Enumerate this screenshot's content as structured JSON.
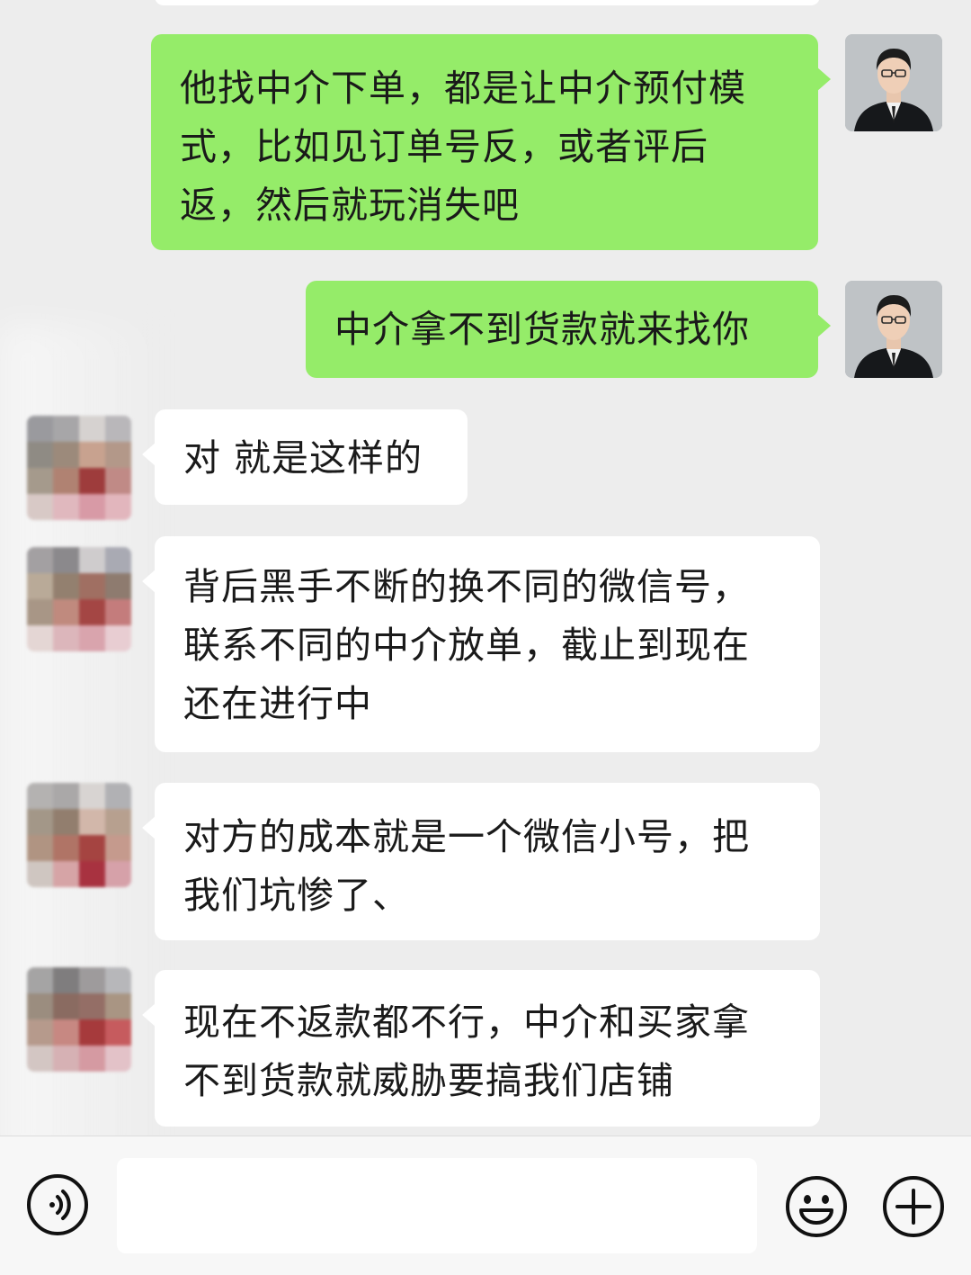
{
  "messages": [
    {
      "side": "me",
      "text": "他找中介下单，都是让中介预付模\n式，比如见订单号反，或者评后\n返，然后就玩消失吧"
    },
    {
      "side": "me",
      "text": "中介拿不到货款就来找你"
    },
    {
      "side": "other",
      "text": "对 就是这样的"
    },
    {
      "side": "other",
      "text": "背后黑手不断的换不同的微信号，\n联系不同的中介放单，截止到现在\n还在进行中"
    },
    {
      "side": "other",
      "text": "对方的成本就是一个微信小号，把\n我们坑惨了、"
    },
    {
      "side": "other",
      "text": "现在不返款都不行，中介和买家拿\n不到货款就威胁要搞我们店铺"
    }
  ],
  "input_bar": {
    "text_value": "",
    "voice_icon": "voice-icon",
    "emoji_icon": "emoji-icon",
    "plus_icon": "plus-icon"
  },
  "colors": {
    "background": "#ededed",
    "my_bubble": "#95ec69",
    "their_bubble": "#ffffff"
  }
}
